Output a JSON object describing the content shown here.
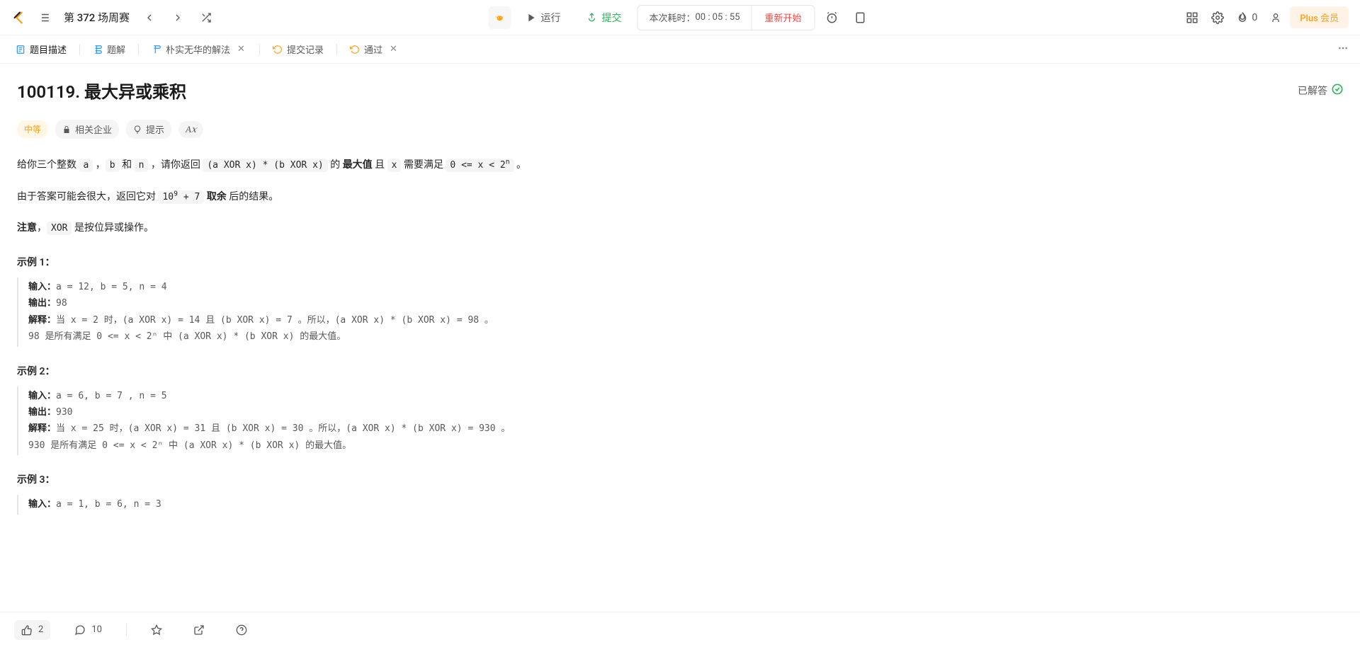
{
  "header": {
    "contest_title": "第 372 场周赛",
    "run_label": "运行",
    "submit_label": "提交",
    "timer_prefix": "本次耗时：",
    "timer_value": "00 : 05 : 55",
    "restart_label": "重新开始",
    "fire_count": "0",
    "plus_label": "Plus 会员"
  },
  "tabs": {
    "desc": "题目描述",
    "solution": "题解",
    "my_solution": "朴实无华的解法",
    "submissions": "提交记录",
    "accepted": "通过"
  },
  "problem": {
    "title": "100119. 最大异或乘积",
    "solved_label": "已解答",
    "difficulty": "中等",
    "companies": "相关企业",
    "hint": "提示",
    "p1_pre": "给你三个整数 ",
    "p1_a": "a",
    "p1_sep1": " ，",
    "p1_b": "b",
    "p1_and": " 和 ",
    "p1_n": "n",
    "p1_mid": " ，请你返回 ",
    "p1_expr": "(a XOR x) * (b XOR x)",
    "p1_the": " 的 ",
    "p1_max": "最大值",
    "p1_and2": " 且 ",
    "p1_x": "x",
    "p1_need": " 需要满足 ",
    "p1_cond": "0 <= x < 2",
    "p1_sup": "n",
    "p1_end": " 。",
    "p2_pre": "由于答案可能会很大，返回它对 ",
    "p2_mod": "10",
    "p2_sup": "9",
    "p2_plus": " + 7",
    "p2_mid": " ",
    "p2_mod_label": "取余",
    "p2_end": " 后的结果。",
    "p3_note": "注意",
    "p3_sep": "，",
    "p3_xor": "XOR",
    "p3_end": " 是按位异或操作。",
    "ex1_title": "示例 1：",
    "ex1_input_label": "输入：",
    "ex1_input": "a = 12, b = 5, n = 4",
    "ex1_output_label": "输出：",
    "ex1_output": "98",
    "ex1_explain_label": "解释：",
    "ex1_explain": "当 x = 2 时，(a XOR x) = 14 且 (b XOR x) = 7 。所以，(a XOR x) * (b XOR x) = 98 。\n98 是所有满足 0 <= x < 2ⁿ 中 (a XOR x) * (b XOR x) 的最大值。",
    "ex2_title": "示例 2：",
    "ex2_input_label": "输入：",
    "ex2_input": "a = 6, b = 7 , n = 5",
    "ex2_output_label": "输出：",
    "ex2_output": "930",
    "ex2_explain_label": "解释：",
    "ex2_explain": "当 x = 25 时，(a XOR x) = 31 且 (b XOR x) = 30 。所以，(a XOR x) * (b XOR x) = 930 。\n930 是所有满足 0 <= x < 2ⁿ 中 (a XOR x) * (b XOR x) 的最大值。",
    "ex3_title": "示例 3：",
    "ex3_input_label": "输入：",
    "ex3_input": "a = 1, b = 6, n = 3"
  },
  "footer": {
    "likes": "2",
    "comments": "10"
  }
}
